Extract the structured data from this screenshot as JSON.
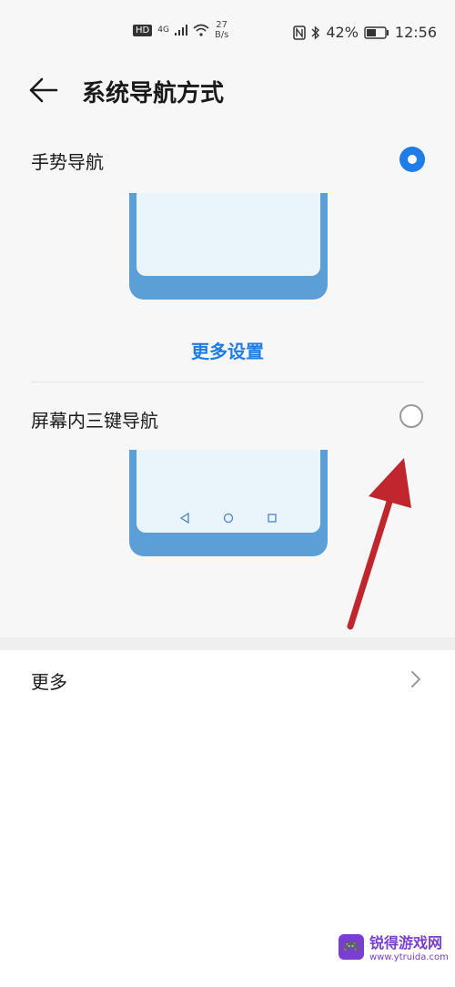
{
  "status_bar": {
    "hd": "HD",
    "network": "4G",
    "speed_value": "27",
    "speed_unit": "B/s",
    "battery": "42%",
    "time": "12:56"
  },
  "header": {
    "title": "系统导航方式"
  },
  "options": [
    {
      "label": "手势导航",
      "selected": true
    },
    {
      "label": "屏幕内三键导航",
      "selected": false
    }
  ],
  "more_settings_link": "更多设置",
  "more_row": {
    "label": "更多"
  },
  "watermark": {
    "main": "锐得游戏网",
    "sub": "www.ytruida.com"
  },
  "colors": {
    "accent": "#1e7de6",
    "phone_frame": "#5b9fd6",
    "annotation_arrow": "#c0272d"
  }
}
